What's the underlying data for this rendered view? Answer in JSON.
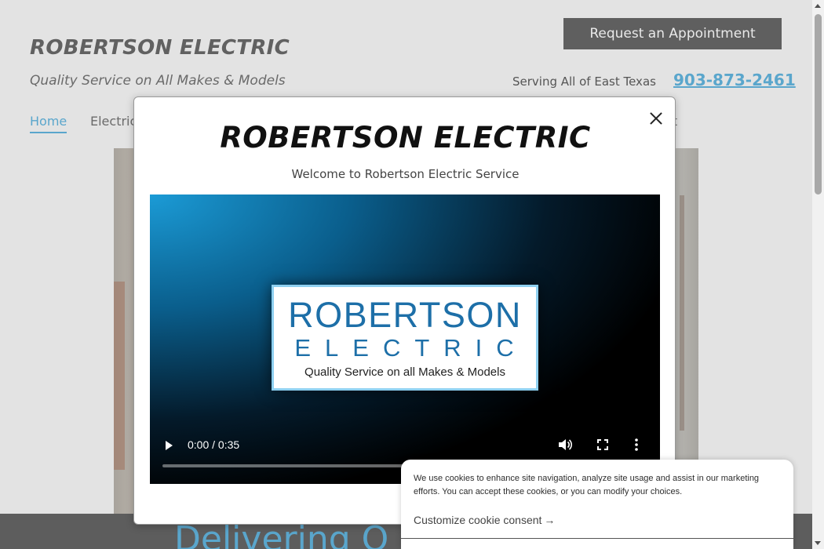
{
  "header": {
    "site_title": "ROBERTSON ELECTRIC",
    "tagline": "Quality Service on All Makes & Models",
    "appointment_button": "Request an Appointment",
    "serving": "Serving All of East Texas",
    "phone": "903-873-2461"
  },
  "nav": {
    "items": [
      {
        "label": "Home",
        "active": true
      },
      {
        "label": "Electric"
      },
      {
        "label": "ct"
      }
    ]
  },
  "hero": {
    "caption": "Delivering Q"
  },
  "modal": {
    "logo_text": "ROBERTSON ELECTRIC",
    "welcome": "Welcome to Robertson Electric Service",
    "video": {
      "card_line1": "ROBERTSON",
      "card_line2": "ELECTRIC",
      "card_line3": "Quality Service on all Makes & Models",
      "time": "0:00 / 0:35",
      "progress": 0
    }
  },
  "cookie": {
    "text": "We use cookies to enhance site navigation, analyze site usage and assist in our marketing efforts. You can accept these cookies, or you can modify your choices.",
    "customize_label": "Customize cookie consent",
    "arrow": "→"
  },
  "colors": {
    "accent": "#5aa6cc",
    "button_bg": "#5f5f5f",
    "video_blue": "#1b9bd6",
    "card_text": "#1d6fa8"
  },
  "icons": {
    "close": "close-icon",
    "play": "play-icon",
    "volume": "volume-icon",
    "fullscreen": "fullscreen-icon",
    "more": "more-vertical-icon"
  }
}
